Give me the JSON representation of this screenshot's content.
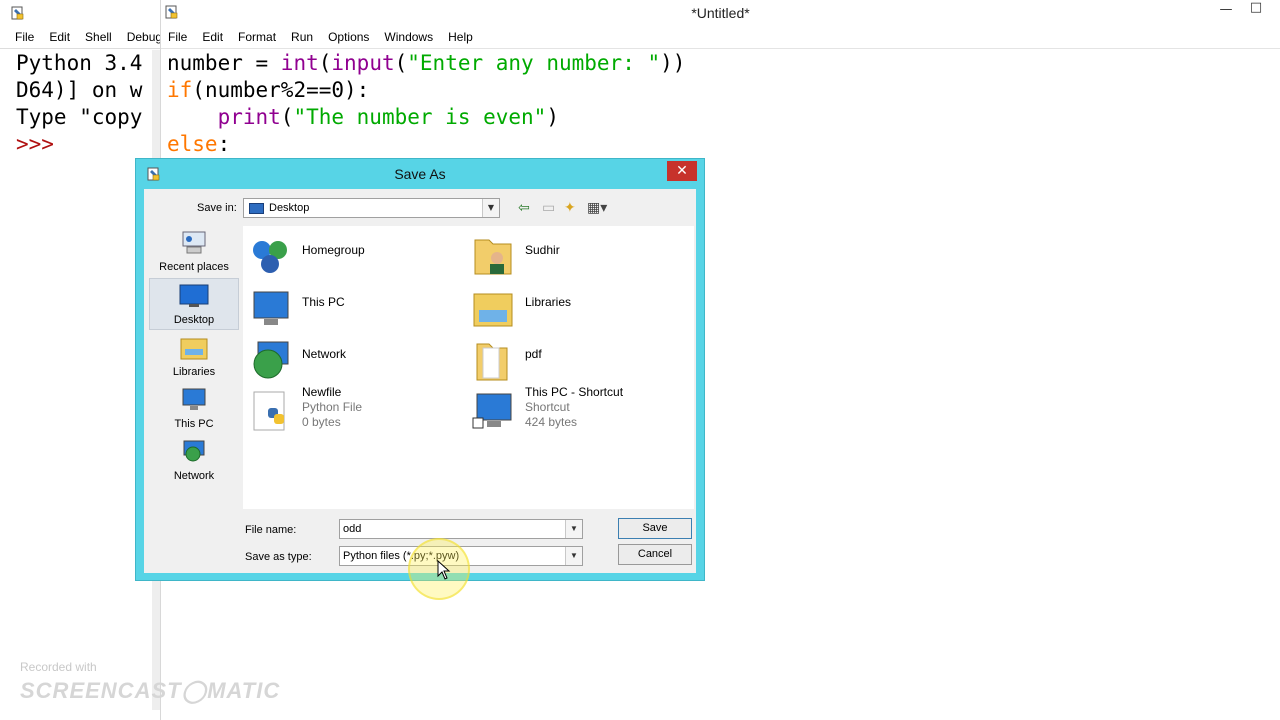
{
  "shell": {
    "menu": [
      "File",
      "Edit",
      "Shell",
      "Debug"
    ],
    "lines": [
      "Python 3.4",
      "D64)] on w",
      "Type \"copy",
      ">>>"
    ]
  },
  "editor": {
    "title": "*Untitled*",
    "menu": [
      "File",
      "Edit",
      "Format",
      "Run",
      "Options",
      "Windows",
      "Help"
    ],
    "code": {
      "l1": {
        "a": "number = ",
        "b": "int",
        "c": "(",
        "d": "input",
        "e": "(",
        "f": "\"Enter any number: \"",
        "g": "))"
      },
      "l2": {
        "a": "if",
        "b": "(number%2==0):"
      },
      "l3": {
        "a": "    ",
        "b": "print",
        "c": "(",
        "d": "\"The number is even\"",
        "e": ")"
      },
      "l4": {
        "a": "else",
        "b": ":"
      }
    }
  },
  "dialog": {
    "title": "Save As",
    "save_in_label": "Save in:",
    "save_in_value": "Desktop",
    "places": [
      "Recent places",
      "Desktop",
      "Libraries",
      "This PC",
      "Network"
    ],
    "items": [
      {
        "name": "Homegroup"
      },
      {
        "name": "Sudhir"
      },
      {
        "name": "This PC"
      },
      {
        "name": "Libraries"
      },
      {
        "name": "Network"
      },
      {
        "name": "pdf"
      },
      {
        "name": "Newfile",
        "type": "Python File",
        "size": "0 bytes"
      },
      {
        "name": "This PC - Shortcut",
        "type": "Shortcut",
        "size": "424 bytes"
      }
    ],
    "file_name_label": "File name:",
    "file_name_value": "odd",
    "save_type_label": "Save as type:",
    "save_type_value": "Python files (*.py;*.pyw)",
    "save_button": "Save",
    "cancel_button": "Cancel"
  },
  "watermark": {
    "line1": "Recorded with",
    "line2": "SCREENCAST◯MATIC"
  },
  "colors": {
    "keyword": "#ff7700",
    "builtin": "#900090",
    "string": "#00aa00",
    "dialog_frame": "#57d4e6",
    "close": "#c7322b"
  }
}
